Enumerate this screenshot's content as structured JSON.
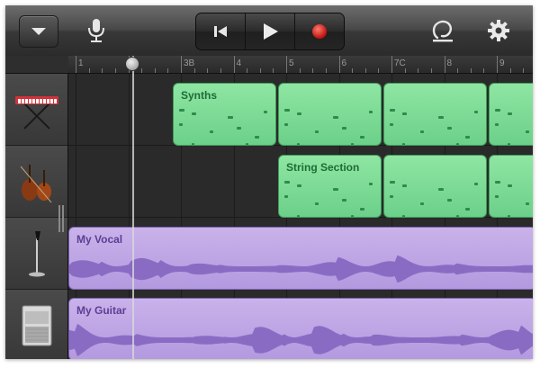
{
  "toolbar": {
    "menu_icon": "chevron-down-icon",
    "mic_icon": "microphone-icon",
    "transport": {
      "rewind_icon": "skip-to-start-icon",
      "play_icon": "play-icon",
      "record_icon": "record-icon",
      "record_color": "#e0201c"
    },
    "loop_icon": "loop-icon",
    "settings_icon": "gear-icon"
  },
  "ruler": {
    "marks": [
      "1",
      "2",
      "3B",
      "4",
      "5",
      "6",
      "7C",
      "8",
      "9"
    ]
  },
  "tracks": [
    {
      "instrument": "keyboard",
      "icon": "keyboard-icon"
    },
    {
      "instrument": "strings",
      "icon": "violin-icon"
    },
    {
      "instrument": "vocal",
      "icon": "microphone-stand-icon"
    },
    {
      "instrument": "guitar",
      "icon": "amplifier-icon"
    }
  ],
  "regions": {
    "synths": {
      "label": "Synths",
      "color": "#7edb96"
    },
    "strings": {
      "label": "String Section",
      "color": "#7edb96"
    },
    "vocal": {
      "label": "My Vocal",
      "color": "#bfa6e6"
    },
    "guitar": {
      "label": "My Guitar",
      "color": "#bfa6e6"
    }
  }
}
